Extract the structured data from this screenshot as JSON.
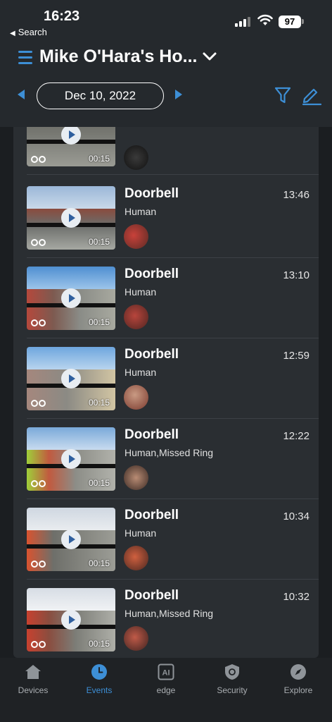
{
  "status_bar": {
    "time": "16:23",
    "back_label": "Search",
    "battery": "97"
  },
  "header": {
    "title": "Mike O'Hara's Ho...",
    "date": "Dec 10, 2022"
  },
  "events": [
    {
      "title": "",
      "tags": "",
      "time": "",
      "duration": "00:15"
    },
    {
      "title": "Doorbell",
      "tags": "Human",
      "time": "13:46",
      "duration": "00:15"
    },
    {
      "title": "Doorbell",
      "tags": "Human",
      "time": "13:10",
      "duration": "00:15"
    },
    {
      "title": "Doorbell",
      "tags": "Human",
      "time": "12:59",
      "duration": "00:15"
    },
    {
      "title": "Doorbell",
      "tags": "Human,Missed Ring",
      "time": "12:22",
      "duration": "00:15"
    },
    {
      "title": "Doorbell",
      "tags": "Human",
      "time": "10:34",
      "duration": "00:15"
    },
    {
      "title": "Doorbell",
      "tags": "Human,Missed Ring",
      "time": "10:32",
      "duration": "00:15"
    }
  ],
  "bottom_nav": {
    "items": [
      {
        "label": "Devices",
        "icon": "house-icon"
      },
      {
        "label": "Events",
        "icon": "clock-icon",
        "active": true
      },
      {
        "label": "edge",
        "icon": "ai-chip-icon"
      },
      {
        "label": "Security",
        "icon": "shield-icon"
      },
      {
        "label": "Explore",
        "icon": "compass-icon"
      }
    ]
  },
  "colors": {
    "accent": "#3d8fd6",
    "header_bg": "#25292d",
    "list_bg": "#2a2e32",
    "nav_bg": "#1f2225"
  }
}
